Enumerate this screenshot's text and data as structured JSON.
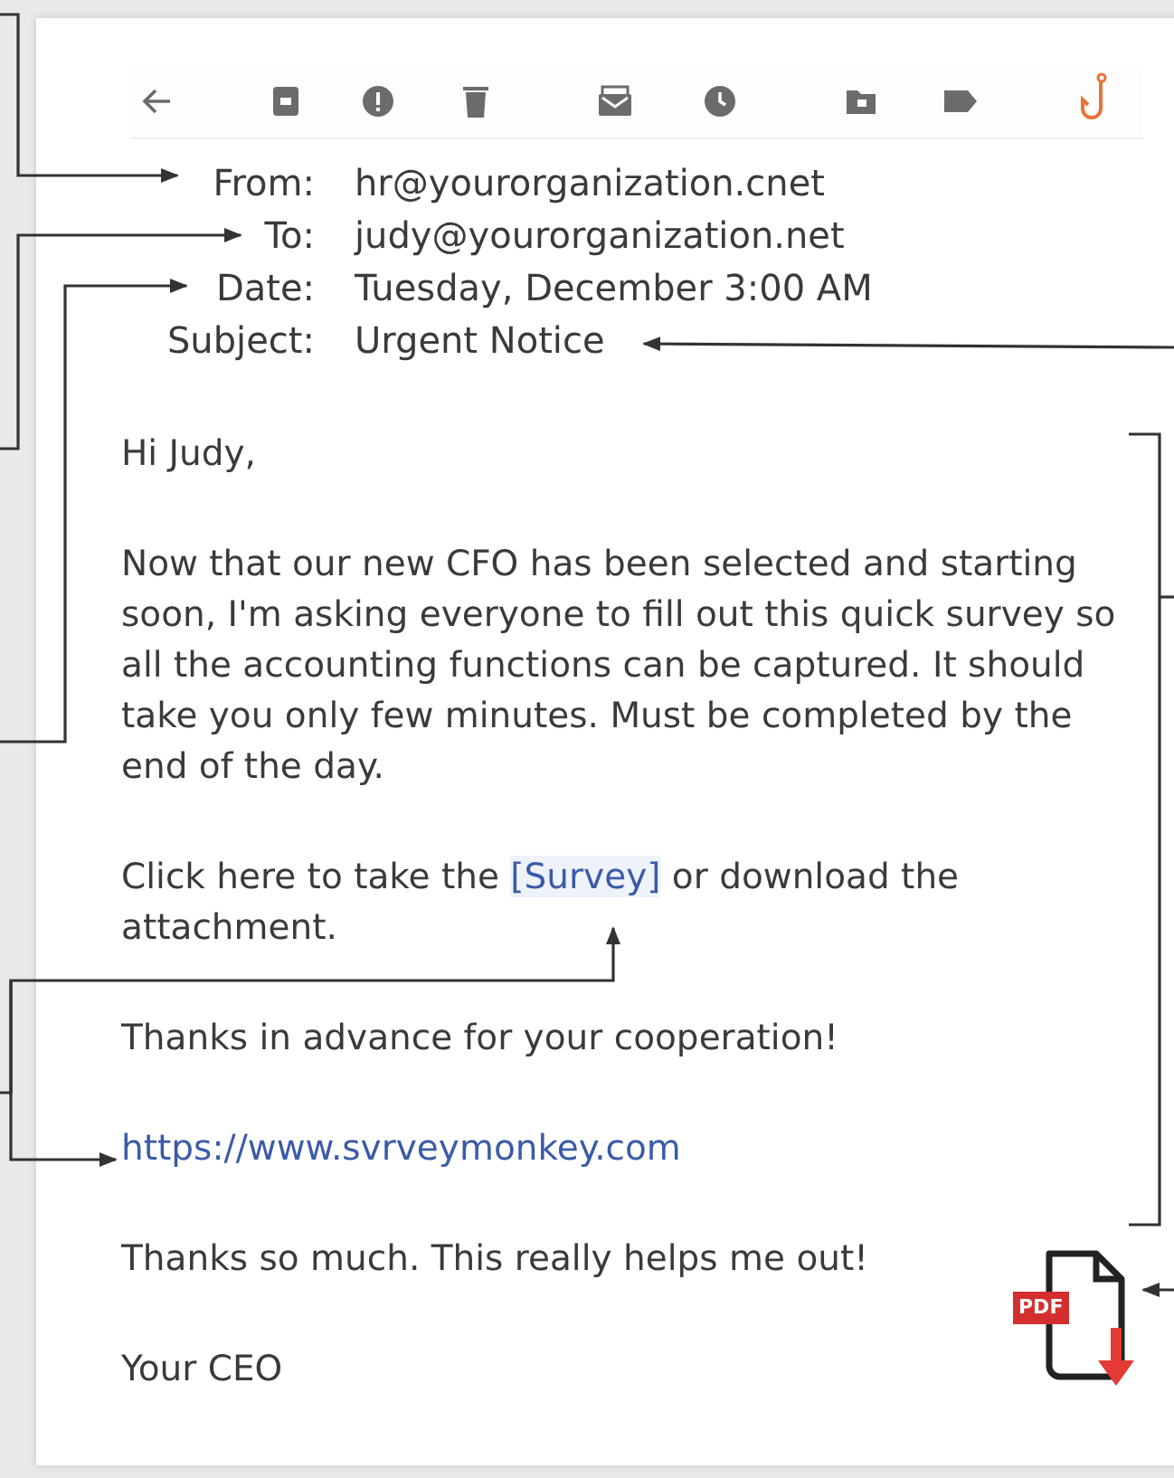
{
  "toolbar": [
    {
      "kind": "back"
    },
    {
      "kind": "archive"
    },
    {
      "kind": "spam"
    },
    {
      "kind": "trash"
    },
    {
      "kind": "mail"
    },
    {
      "kind": "clock"
    },
    {
      "kind": "folder"
    },
    {
      "kind": "tag"
    },
    {
      "kind": "hook"
    }
  ],
  "headers": [
    {
      "label": "From:",
      "value": "hr@yourorganization.cnet"
    },
    {
      "label": "To:",
      "value": "judy@yourorganization.net"
    },
    {
      "label": "Date:",
      "value": "Tuesday, December 3:00 AM"
    },
    {
      "label": "Subject:",
      "value": "Urgent Notice"
    }
  ],
  "body": [
    {
      "kind": "text",
      "text": "Hi Judy,"
    },
    {
      "kind": "text",
      "text": "Now that our new CFO has been selected and starting soon, I'm asking everyone to fill out this quick survey so all the accounting functions can be captured. It should take you only few minutes. Must be completed by the end of the day."
    },
    {
      "kind": "link_sentence",
      "before": "Click here to take the ",
      "link": "[Survey]",
      "after": " or download the attachment."
    },
    {
      "kind": "text",
      "text": "Thanks in advance for your cooperation!"
    },
    {
      "kind": "url",
      "text": "https://www.svrveymonkey.com"
    },
    {
      "kind": "text",
      "text": "Thanks so much. This really helps me out!"
    },
    {
      "kind": "text",
      "text": "Your CEO"
    }
  ],
  "attachment": {
    "label": "PDF"
  }
}
